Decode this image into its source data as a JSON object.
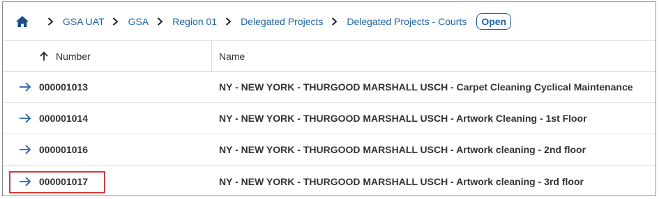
{
  "breadcrumb": {
    "items": [
      "GSA UAT",
      "GSA",
      "Region 01",
      "Delegated Projects",
      "Delegated Projects - Courts"
    ],
    "status": "Open"
  },
  "table": {
    "columns": [
      {
        "label": "Number",
        "sort": "ascending"
      },
      {
        "label": "Name"
      }
    ],
    "rows": [
      {
        "number": "000001013",
        "name": "NY - NEW YORK - THURGOOD MARSHALL USCH - Carpet Cleaning Cyclical Maintenance"
      },
      {
        "number": "000001014",
        "name": "NY - NEW YORK - THURGOOD MARSHALL USCH - Artwork Cleaning - 1st Floor"
      },
      {
        "number": "000001016",
        "name": "NY - NEW YORK - THURGOOD MARSHALL USCH - Artwork cleaning - 2nd floor"
      },
      {
        "number": "000001017",
        "name": "NY - NEW YORK - THURGOOD MARSHALL USCH - Artwork cleaning - 3rd floor"
      }
    ]
  },
  "colors": {
    "link": "#1c62a8",
    "highlight": "#d33a3a",
    "text": "#333333"
  },
  "icons": {
    "home": "home-icon",
    "separator": "chevron-right-icon",
    "sort": "arrow-up-icon",
    "row_action": "arrow-right-icon"
  }
}
